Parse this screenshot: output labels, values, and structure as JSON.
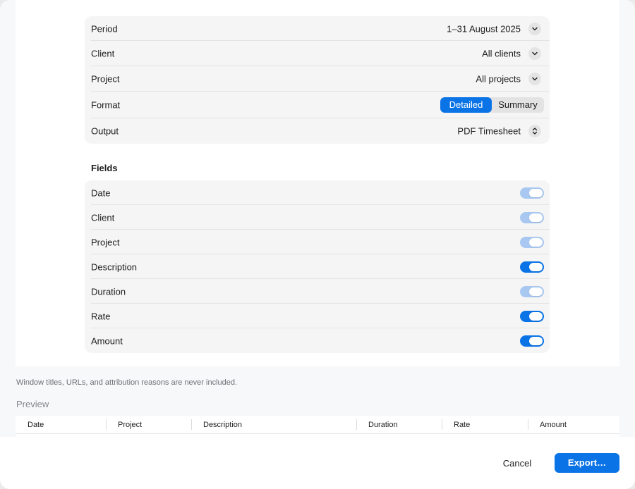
{
  "settings": {
    "period": {
      "label": "Period",
      "value": "1–31 August 2025",
      "icon": "chevron-down-icon"
    },
    "client": {
      "label": "Client",
      "value": "All clients",
      "icon": "chevron-down-icon"
    },
    "project": {
      "label": "Project",
      "value": "All projects",
      "icon": "chevron-down-icon"
    },
    "format": {
      "label": "Format",
      "options": [
        "Detailed",
        "Summary"
      ],
      "selected": "Detailed"
    },
    "output": {
      "label": "Output",
      "value": "PDF Timesheet",
      "icon": "chevron-up-down-icon"
    }
  },
  "fields": {
    "title": "Fields",
    "items": [
      {
        "label": "Date",
        "enabled": true,
        "editable": false
      },
      {
        "label": "Client",
        "enabled": true,
        "editable": false
      },
      {
        "label": "Project",
        "enabled": true,
        "editable": false
      },
      {
        "label": "Description",
        "enabled": true,
        "editable": true
      },
      {
        "label": "Duration",
        "enabled": true,
        "editable": false
      },
      {
        "label": "Rate",
        "enabled": true,
        "editable": true
      },
      {
        "label": "Amount",
        "enabled": true,
        "editable": true
      }
    ]
  },
  "note": "Window titles, URLs, and attribution reasons are never included.",
  "preview": {
    "title": "Preview",
    "columns": [
      "Date",
      "Project",
      "Description",
      "Duration",
      "Rate",
      "Amount"
    ]
  },
  "footer": {
    "cancel_label": "Cancel",
    "export_label": "Export…"
  },
  "colors": {
    "accent": "#0a73e6",
    "toggle_disabled": "#a9c8f1",
    "group_background": "#f5f5f5"
  }
}
